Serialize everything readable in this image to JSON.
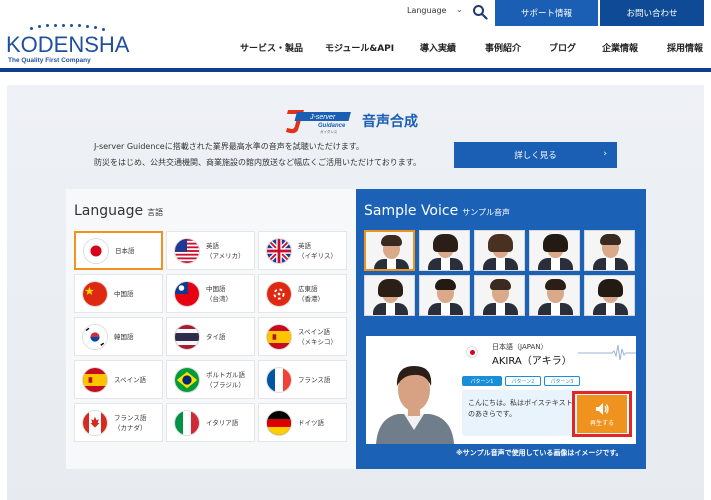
{
  "header": {
    "logo_text": "KODENSHA",
    "logo_tagline": "The Quality First Company",
    "language_label": "Language",
    "support_button": "サポート情報",
    "contact_button": "お問い合わせ",
    "nav": [
      "サービス・製品",
      "モジュール&API",
      "導入実績",
      "事例紹介",
      "ブログ",
      "企業情報",
      "採用情報"
    ]
  },
  "hero": {
    "logo_primary": "J-server",
    "logo_secondary": "Guidance",
    "logo_small": "ガイダンス",
    "title": "音声合成",
    "description_line1": "J-server Guidenceに搭載された業界最高水準の音声を試聴いただけます。",
    "description_line2": "防災をはじめ、公共交通機関、商業施設の館内放送など幅広くご活用いただけております。",
    "details_button": "詳しく見る",
    "details_arrow": "›"
  },
  "language_panel": {
    "heading": "Language",
    "heading_sub": "言語",
    "languages": [
      {
        "label": "日本語",
        "flag": "jp"
      },
      {
        "label": "英語\n（アメリカ）",
        "flag": "us"
      },
      {
        "label": "英語\n（イギリス）",
        "flag": "uk"
      },
      {
        "label": "中国語",
        "flag": "cn"
      },
      {
        "label": "中国語\n（台湾）",
        "flag": "tw"
      },
      {
        "label": "広東語\n（香港）",
        "flag": "hk"
      },
      {
        "label": "韓国語",
        "flag": "kr"
      },
      {
        "label": "タイ語",
        "flag": "th"
      },
      {
        "label": "スペイン語\n（メキシコ）",
        "flag": "es"
      },
      {
        "label": "スペイン語",
        "flag": "es"
      },
      {
        "label": "ポルトガル語\n（ブラジル）",
        "flag": "br"
      },
      {
        "label": "フランス語",
        "flag": "fr"
      },
      {
        "label": "フランス語\n（カナダ）",
        "flag": "ca"
      },
      {
        "label": "イタリア語",
        "flag": "it"
      },
      {
        "label": "ドイツ語",
        "flag": "de"
      }
    ],
    "selected_index": 0
  },
  "voice_panel": {
    "heading": "Sample Voice",
    "heading_sub": "サンプル音声",
    "selected_index": 0,
    "detail": {
      "language": "日本語（JAPAN）",
      "name": "AKIRA（アキラ）",
      "patterns": [
        "パターン1",
        "パターン2",
        "パターン3"
      ],
      "speech": "こんにちは。私はボイステキスト\nのあきらです。",
      "play_label": "再生する"
    },
    "note": "※サンプル音声で使用している画像はイメージです。"
  },
  "colors": {
    "brand_blue": "#1a5fb4",
    "dark_blue": "#0d3f8c",
    "accent_orange": "#f0921e",
    "highlight_red": "#e02626"
  }
}
